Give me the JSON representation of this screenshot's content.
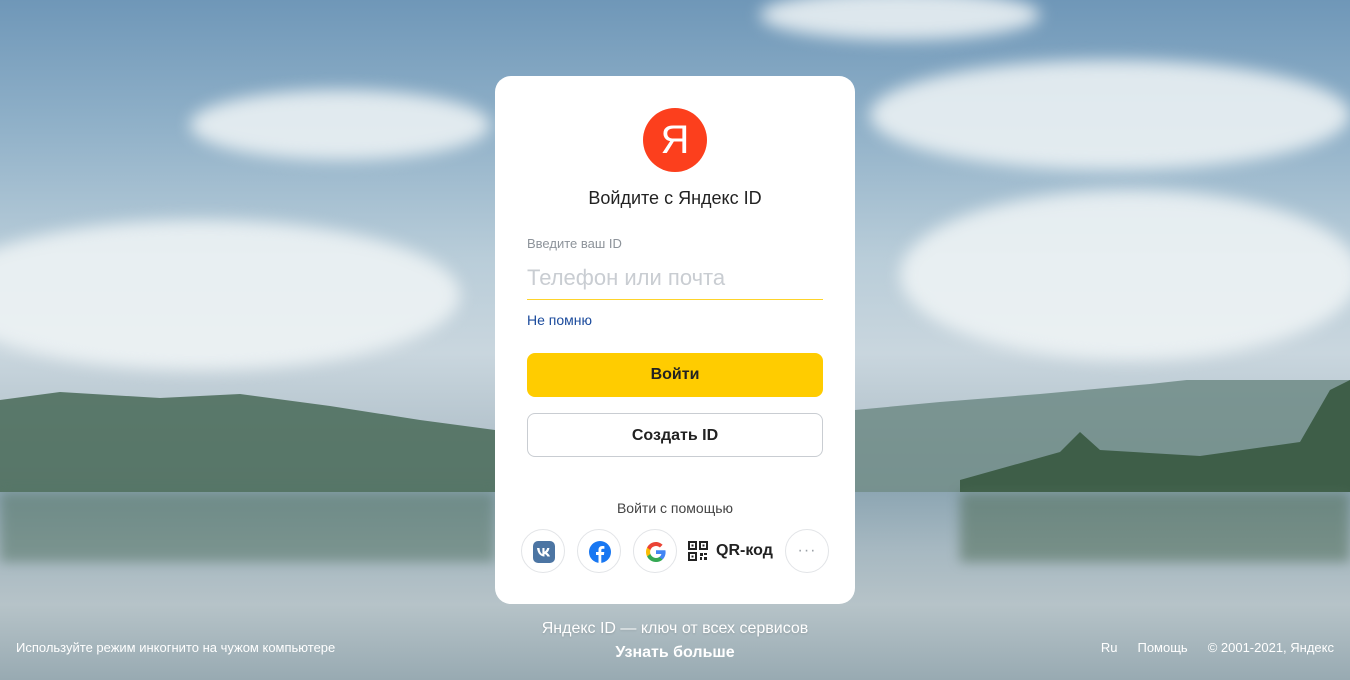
{
  "card": {
    "logo_letter": "Я",
    "title": "Войдите с Яндекс ID",
    "field_label": "Введите ваш ID",
    "field_placeholder": "Телефон или почта",
    "forgot_link": "Не помню",
    "login_button": "Войти",
    "create_button": "Создать ID",
    "alt_login_title": "Войти с помощью",
    "social": [
      {
        "icon": "vk-icon"
      },
      {
        "icon": "facebook-icon"
      },
      {
        "icon": "google-icon"
      }
    ],
    "qr_label": "QR-код",
    "more_label": "···"
  },
  "bottom": {
    "tagline": "Яндекс ID — ключ от всех сервисов",
    "learn_more": "Узнать больше"
  },
  "footer": {
    "incognito_hint": "Используйте режим инкогнито на чужом компьютере",
    "language": "Ru",
    "help": "Помощь",
    "copyright": "© 2001-2021, Яндекс"
  },
  "colors": {
    "brand_red": "#fc3f1d",
    "accent_yellow": "#ffcc00",
    "link_blue": "#1a4a9c"
  }
}
